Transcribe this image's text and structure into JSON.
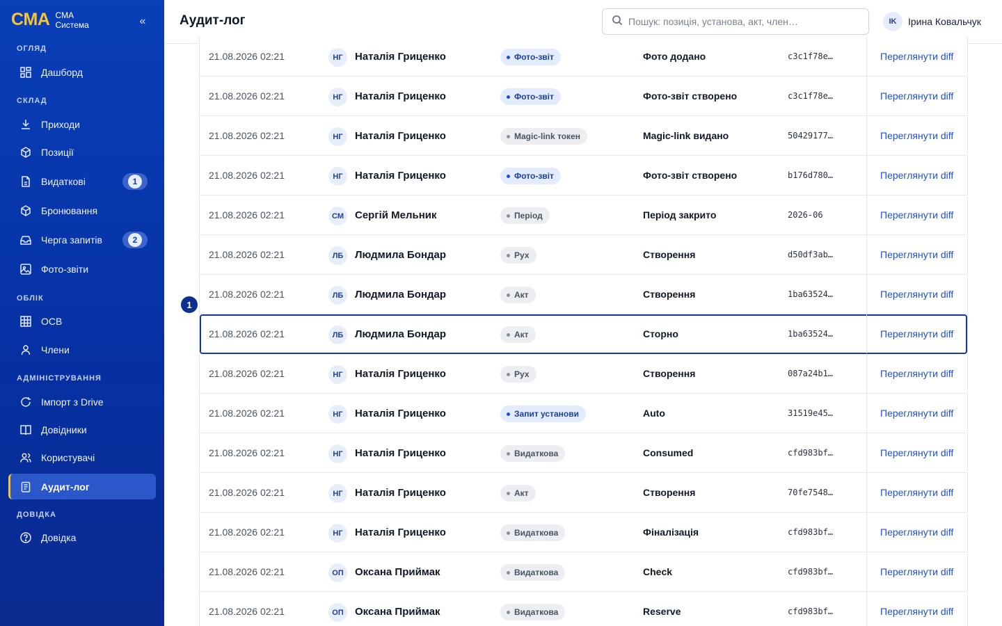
{
  "sidebar": {
    "brand": {
      "logo": "CMA",
      "line1": "CMA",
      "line2": "Система"
    },
    "collapse_label": "«",
    "sections": {
      "overview": "Огляд",
      "warehouse": "Склад",
      "accounting": "Облік",
      "admin": "Адміністрування",
      "help": "Довідка"
    },
    "items": [
      {
        "label": "Дашборд",
        "icon": "grid-icon"
      },
      {
        "label": "Приходи",
        "icon": "download-icon"
      },
      {
        "label": "Позиції",
        "icon": "box-icon"
      },
      {
        "label": "Видаткові",
        "icon": "document-icon",
        "badge": "1"
      },
      {
        "label": "Бронювання",
        "icon": "box-icon"
      },
      {
        "label": "Черга запитів",
        "icon": "inbox-icon",
        "badge": "2"
      },
      {
        "label": "Фото-звіти",
        "icon": "image-icon"
      },
      {
        "label": "ОСВ",
        "icon": "table-icon"
      },
      {
        "label": "Члени",
        "icon": "user-icon"
      },
      {
        "label": "Імпорт з Drive",
        "icon": "refresh-icon"
      },
      {
        "label": "Довідники",
        "icon": "book-icon"
      },
      {
        "label": "Користувачі",
        "icon": "users-icon"
      },
      {
        "label": "Аудит-лог",
        "icon": "clipboard-icon",
        "active": true
      },
      {
        "label": "Довідка",
        "icon": "help-icon"
      }
    ]
  },
  "header": {
    "title": "Аудит-лог",
    "search_placeholder": "Пошук: позиція, установа, акт, член…",
    "user": {
      "initials": "IK",
      "name": "Ірина Ковальчук"
    }
  },
  "marker": "1",
  "audit_rows": [
    {
      "time": "21.08.2026 02:21",
      "initials": "НГ",
      "user": "Наталія Гриценко",
      "entity": "Фото-звіт",
      "entity_accent": true,
      "action": "Фото додано",
      "id": "c3c1f78e…",
      "link": "Переглянути diff"
    },
    {
      "time": "21.08.2026 02:21",
      "initials": "НГ",
      "user": "Наталія Гриценко",
      "entity": "Фото-звіт",
      "entity_accent": true,
      "action": "Фото-звіт створено",
      "id": "c3c1f78e…",
      "link": "Переглянути diff"
    },
    {
      "time": "21.08.2026 02:21",
      "initials": "НГ",
      "user": "Наталія Гриценко",
      "entity": "Magic-link токен",
      "entity_accent": false,
      "action": "Magic-link видано",
      "id": "50429177…",
      "link": "Переглянути diff"
    },
    {
      "time": "21.08.2026 02:21",
      "initials": "НГ",
      "user": "Наталія Гриценко",
      "entity": "Фото-звіт",
      "entity_accent": true,
      "action": "Фото-звіт створено",
      "id": "b176d780…",
      "link": "Переглянути diff"
    },
    {
      "time": "21.08.2026 02:21",
      "initials": "СМ",
      "user": "Сергій Мельник",
      "entity": "Період",
      "entity_accent": false,
      "action": "Період закрито",
      "id": "2026-06",
      "link": "Переглянути diff"
    },
    {
      "time": "21.08.2026 02:21",
      "initials": "ЛБ",
      "user": "Людмила Бондар",
      "entity": "Рух",
      "entity_accent": false,
      "action": "Створення",
      "id": "d50df3ab…",
      "link": "Переглянути diff"
    },
    {
      "time": "21.08.2026 02:21",
      "initials": "ЛБ",
      "user": "Людмила Бондар",
      "entity": "Акт",
      "entity_accent": false,
      "action": "Створення",
      "id": "1ba63524…",
      "link": "Переглянути diff"
    },
    {
      "time": "21.08.2026 02:21",
      "initials": "ЛБ",
      "user": "Людмила Бондар",
      "entity": "Акт",
      "entity_accent": false,
      "action": "Сторно",
      "id": "1ba63524…",
      "link": "Переглянути diff",
      "selected": true
    },
    {
      "time": "21.08.2026 02:21",
      "initials": "НГ",
      "user": "Наталія Гриценко",
      "entity": "Рух",
      "entity_accent": false,
      "action": "Створення",
      "id": "087a24b1…",
      "link": "Переглянути diff"
    },
    {
      "time": "21.08.2026 02:21",
      "initials": "НГ",
      "user": "Наталія Гриценко",
      "entity": "Запит установи",
      "entity_accent": true,
      "action": "Auto",
      "id": "31519e45…",
      "link": "Переглянути diff"
    },
    {
      "time": "21.08.2026 02:21",
      "initials": "НГ",
      "user": "Наталія Гриценко",
      "entity": "Видаткова",
      "entity_accent": false,
      "action": "Consumed",
      "id": "cfd983bf…",
      "link": "Переглянути diff"
    },
    {
      "time": "21.08.2026 02:21",
      "initials": "НГ",
      "user": "Наталія Гриценко",
      "entity": "Акт",
      "entity_accent": false,
      "action": "Створення",
      "id": "70fe7548…",
      "link": "Переглянути diff"
    },
    {
      "time": "21.08.2026 02:21",
      "initials": "НГ",
      "user": "Наталія Гриценко",
      "entity": "Видаткова",
      "entity_accent": false,
      "action": "Фіналізація",
      "id": "cfd983bf…",
      "link": "Переглянути diff"
    },
    {
      "time": "21.08.2026 02:21",
      "initials": "ОП",
      "user": "Оксана Приймак",
      "entity": "Видаткова",
      "entity_accent": false,
      "action": "Check",
      "id": "cfd983bf…",
      "link": "Переглянути diff"
    },
    {
      "time": "21.08.2026 02:21",
      "initials": "ОП",
      "user": "Оксана Приймак",
      "entity": "Видаткова",
      "entity_accent": false,
      "action": "Reserve",
      "id": "cfd983bf…",
      "link": "Переглянути diff"
    }
  ]
}
